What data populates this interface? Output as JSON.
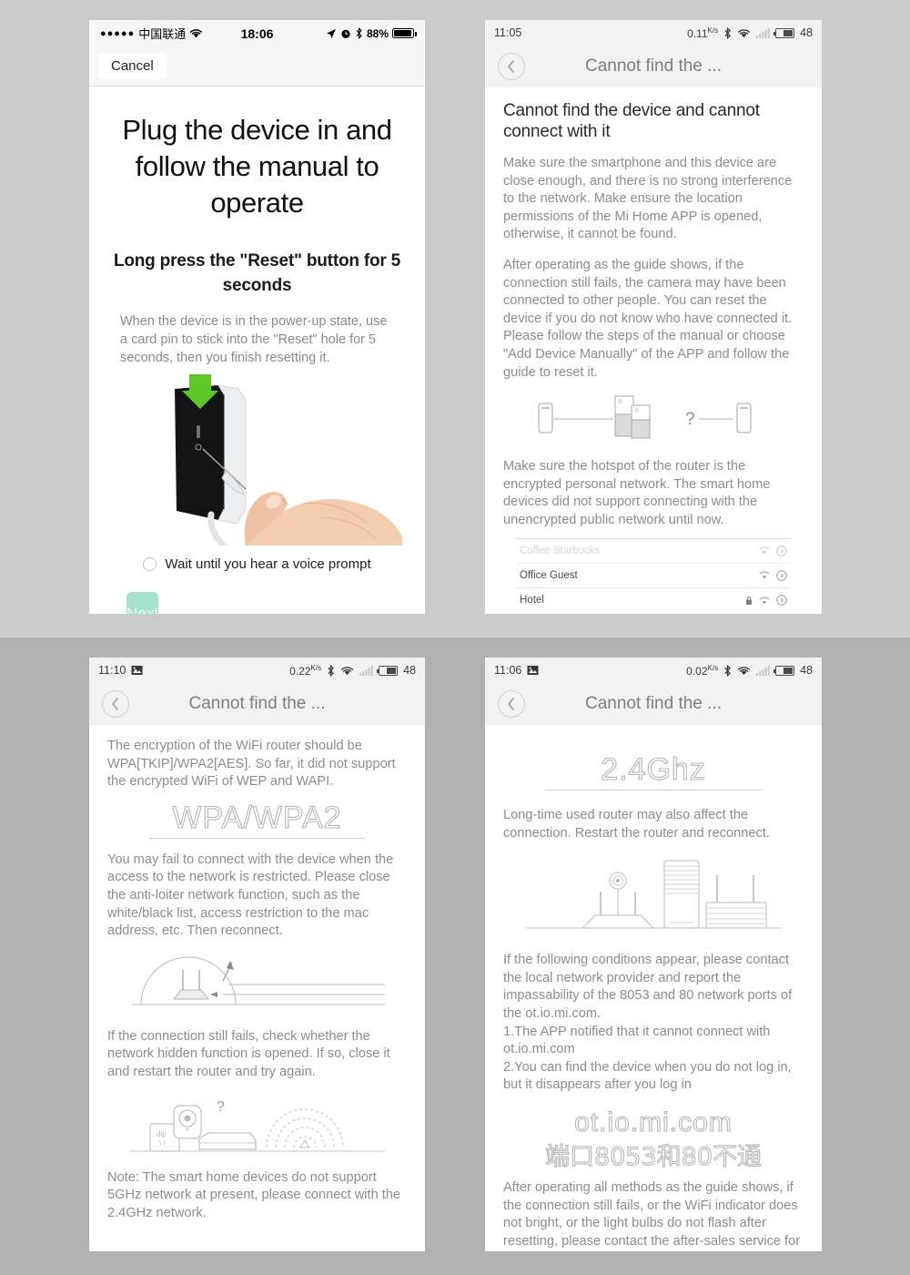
{
  "background": {
    "top_color": "#cbcbcb",
    "bottom_color": "#b1b1b1"
  },
  "accent": {
    "next_button": "#a5e3ce",
    "arrow_green": "#5ec926"
  },
  "panel1": {
    "status": {
      "signal_dots": "●●●●●",
      "carrier": "中国联通",
      "wifi_icon": "wifi-icon",
      "time": "18:06",
      "location_icon": "location-arrow-icon",
      "alarm_icon": "alarm-icon",
      "bluetooth_icon": "bluetooth-icon",
      "battery_percent": "88%"
    },
    "navbar": {
      "cancel_label": "Cancel"
    },
    "title": "Plug the device in and follow the manual to operate",
    "subtitle": "Long press the \"Reset\" button for 5 seconds",
    "description": "When the device is in the power-up state, use a card pin to stick into the \"Reset\" hole for 5 seconds, then you finish resetting it.",
    "illustration_name": "hand-pressing-reset-pin-photo",
    "checkbox_label": "Wait until you hear a voice prompt",
    "next_label": "Next"
  },
  "panel2": {
    "status": {
      "time": "11:05",
      "data_rate": "0.11",
      "data_unit": "K/s",
      "bluetooth_icon": "bluetooth-icon",
      "wifi_icon": "wifi-icon",
      "signal_icon": "cell-signal-icon",
      "battery_percent": "48"
    },
    "navbar": {
      "back_icon": "chevron-left-icon",
      "title": "Cannot find the ..."
    },
    "heading": "Cannot find the device and cannot connect with it",
    "paragraphs": [
      "Make sure the smartphone and this device are close enough, and there is no strong interference to the network. Make ensure the location permissions of the Mi Home APP is opened, otherwise, it cannot be found.",
      "After operating as the guide shows, if the connection still fails, the camera may have been connected to other people. You can reset the device if you do not know who have connected it. Please follow the steps of the manual or choose \"Add Device Manually\" of the APP and follow the guide to reset it.",
      "Make sure the hotspot of the router is the encrypted personal network. The smart home devices did not support connecting with the unencrypted public network until now."
    ],
    "illustration_name": "phone-router-phone-question-diagram",
    "question_mark": "?",
    "wifi_list": [
      {
        "name": "Coffee Starbucks",
        "locked": false,
        "faded": true
      },
      {
        "name": "Office Guest",
        "locked": false,
        "faded": false
      },
      {
        "name": "Hotel",
        "locked": true,
        "faded": false
      }
    ]
  },
  "panel3": {
    "status": {
      "time": "11:10",
      "photo_icon": "image-icon",
      "data_rate": "0.22",
      "data_unit": "K/s",
      "battery_percent": "48"
    },
    "navbar": {
      "back_icon": "chevron-left-icon",
      "title": "Cannot find the ..."
    },
    "paragraph1": "The encryption of the WiFi router should be WPA[TKIP]/WPA2[AES]. So far, it did not support the encrypted WiFi of WEP and WAPI.",
    "outline_label": "WPA/WPA2",
    "paragraph2": "You may fail to connect with the device when the access to the network is restricted. Please close the anti-loiter network function, such as the white/black list, access restriction to the mac address, etc. Then reconnect.",
    "illustration1_name": "router-signal-dome-diagram",
    "paragraph3": "If the connection still fails, check whether the network hidden function is opened. If so, close it and restart the router and try again.",
    "illustration2_name": "camera-router-wifi-question-diagram",
    "note": "Note: The smart home devices do not support 5GHz network at present, please connect with the 2.4GHz network."
  },
  "panel4": {
    "status": {
      "time": "11:06",
      "photo_icon": "image-icon",
      "data_rate": "0.02",
      "data_unit": "K/s",
      "battery_percent": "48"
    },
    "navbar": {
      "back_icon": "chevron-left-icon",
      "title": "Cannot find the ..."
    },
    "outline_label": "2.4Ghz",
    "paragraph1": "Long-time used router may also affect the connection. Restart the router and reconnect.",
    "illustration_name": "routers-and-camera-lineup-diagram",
    "paragraph2": "If the following conditions appear, please contact the local network provider and report the impassability of the 8053 and 80 network ports of the ot.io.mi.com.\n1.The APP notified that it cannot connect with ot.io.mi.com\n2.You can find the device when you do not log in, but it disappears after you log in",
    "outline_domain": "ot.io.mi.com",
    "outline_domain_cn": "端口8053和80不通",
    "paragraph3": "After operating all methods as the guide shows, if the connection still fails, or the WiFi indicator does not bright, or the light bulbs do not flash after resetting, please contact the after-sales service for more help."
  }
}
